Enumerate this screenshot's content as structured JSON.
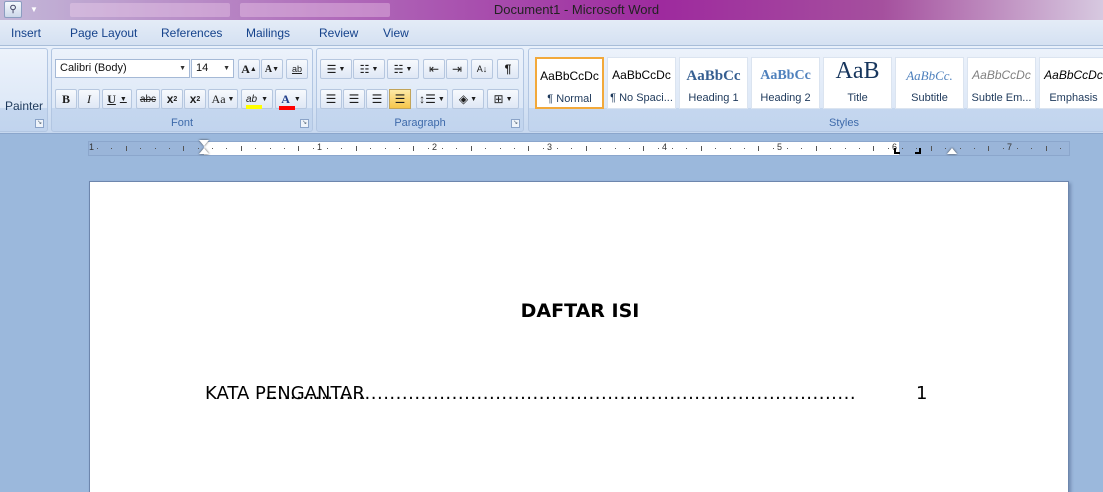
{
  "window": {
    "title": "Document1 - Microsoft Word",
    "quick_access": [
      {
        "name": "print-preview-icon",
        "glyph": "🔍"
      }
    ]
  },
  "ribbon_tabs": [
    "Insert",
    "Page Layout",
    "References",
    "Mailings",
    "Review",
    "View"
  ],
  "clipboard": {
    "format_painter_label": "Painter"
  },
  "font": {
    "group_label": "Font",
    "family": "Calibri (Body)",
    "size": "14",
    "grow_label": "A",
    "shrink_label": "A",
    "clear_label": "ab",
    "bold": "B",
    "italic": "I",
    "underline": "U",
    "strike": "abc",
    "subscript": "x",
    "subscript_mark": "2",
    "superscript": "x",
    "superscript_mark": "2",
    "change_case": "Aa",
    "highlight": "ab",
    "font_color": "A",
    "highlight_color": "#ffff00",
    "font_color_swatch": "#ff0000"
  },
  "paragraph": {
    "group_label": "Paragraph",
    "show_marks": "¶",
    "sort": "A↓"
  },
  "styles": {
    "group_label": "Styles",
    "items": [
      {
        "sample": "AaBbCcDc",
        "name": "¶ Normal",
        "selected": true
      },
      {
        "sample": "AaBbCcDc",
        "name": "¶ No Spaci..."
      },
      {
        "sample": "AaBbCc",
        "name": "Heading 1"
      },
      {
        "sample": "AaBbCc",
        "name": "Heading 2"
      },
      {
        "sample": "AaB",
        "name": "Title"
      },
      {
        "sample": "AaBbCc.",
        "name": "Subtitle"
      },
      {
        "sample": "AaBbCcDc",
        "name": "Subtle Em..."
      },
      {
        "sample": "AaBbCcDc",
        "name": "Emphasis"
      }
    ]
  },
  "ruler": {
    "numbers": [
      "1",
      "1",
      "2",
      "3",
      "4",
      "5",
      "6",
      "7"
    ]
  },
  "document": {
    "heading": "DAFTAR ISI",
    "toc": [
      {
        "label": "KATA PENGANTAR",
        "leader": "...............................................................................................",
        "page": "1"
      }
    ]
  }
}
